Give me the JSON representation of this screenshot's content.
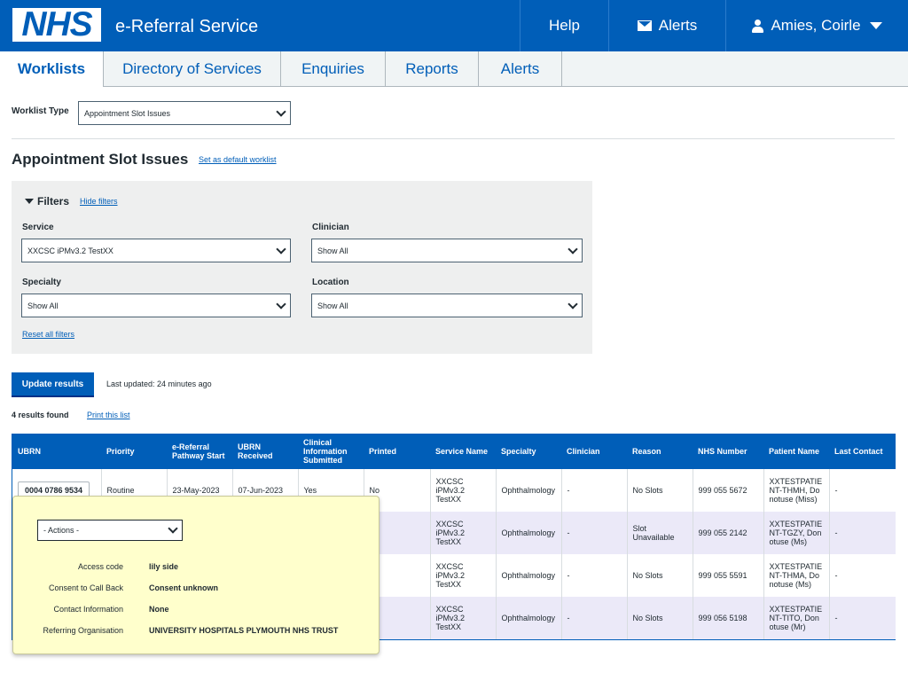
{
  "header": {
    "logo": "NHS",
    "service_name": "e-Referral Service",
    "help": "Help",
    "alerts": "Alerts",
    "user": "Amies, Coirle"
  },
  "tabs": [
    {
      "label": "Worklists",
      "active": true
    },
    {
      "label": "Directory of Services"
    },
    {
      "label": "Enquiries"
    },
    {
      "label": "Reports"
    },
    {
      "label": "Alerts"
    }
  ],
  "worklist": {
    "type_label": "Worklist Type",
    "type_value": "Appointment Slot Issues",
    "title": "Appointment Slot Issues",
    "set_default": "Set as default worklist"
  },
  "filters": {
    "title": "Filters",
    "hide": "Hide filters",
    "service_label": "Service",
    "service_value": "XXCSC iPMv3.2 TestXX",
    "clinician_label": "Clinician",
    "clinician_value": "Show All",
    "specialty_label": "Specialty",
    "specialty_value": "Show All",
    "location_label": "Location",
    "location_value": "Show All",
    "reset": "Reset all filters"
  },
  "update": {
    "button": "Update results",
    "last_updated": "Last updated: 24 minutes ago"
  },
  "results": {
    "count": "4 results found",
    "print": "Print this list"
  },
  "table": {
    "headers": [
      "UBRN",
      "Priority",
      "e-Referral Pathway Start",
      "UBRN Received",
      "Clinical Information Submitted",
      "Printed",
      "Service Name",
      "Specialty",
      "Clinician",
      "Reason",
      "NHS Number",
      "Patient Name",
      "Last Contact"
    ],
    "rows": [
      {
        "ubrn": "0004 0786 9534",
        "priority": "Routine",
        "start": "23-May-2023",
        "received": "07-Jun-2023",
        "clinical": "Yes",
        "printed": "No",
        "service": "XXCSC iPMv3.2 TestXX",
        "specialty": "Ophthalmology",
        "clinician": "-",
        "reason": "No Slots",
        "nhs": "999 055 5672",
        "patient": "XXTESTPATIENT-THMH, Donotuse (Miss)",
        "last": "-"
      },
      {
        "ubrn": "",
        "priority": "",
        "start": "",
        "received": "",
        "clinical": "",
        "printed": "",
        "service": "XXCSC iPMv3.2 TestXX",
        "specialty": "Ophthalmology",
        "clinician": "-",
        "reason": "Slot Unavailable",
        "nhs": "999 055 2142",
        "patient": "XXTESTPATIENT-TGZY, Donotuse (Ms)",
        "last": "-"
      },
      {
        "ubrn": "",
        "priority": "",
        "start": "",
        "received": "",
        "clinical": "",
        "printed": "",
        "service": "XXCSC iPMv3.2 TestXX",
        "specialty": "Ophthalmology",
        "clinician": "-",
        "reason": "No Slots",
        "nhs": "999 055 5591",
        "patient": "XXTESTPATIENT-THMA, Donotuse (Ms)",
        "last": "-"
      },
      {
        "ubrn": "",
        "priority": "",
        "start": "",
        "received": "",
        "clinical": "",
        "printed": "",
        "service": "XXCSC iPMv3.2 TestXX",
        "specialty": "Ophthalmology",
        "clinician": "-",
        "reason": "No Slots",
        "nhs": "999 056 5198",
        "patient": "XXTESTPATIENT-TITO, Donotuse (Mr)",
        "last": "-"
      }
    ]
  },
  "popup": {
    "actions": "- Actions -",
    "access_code_label": "Access code",
    "access_code": "lily side",
    "consent_label": "Consent to Call Back",
    "consent": "Consent unknown",
    "contact_label": "Contact Information",
    "contact": "None",
    "referring_label": "Referring Organisation",
    "referring": "UNIVERSITY HOSPITALS PLYMOUTH NHS TRUST"
  }
}
